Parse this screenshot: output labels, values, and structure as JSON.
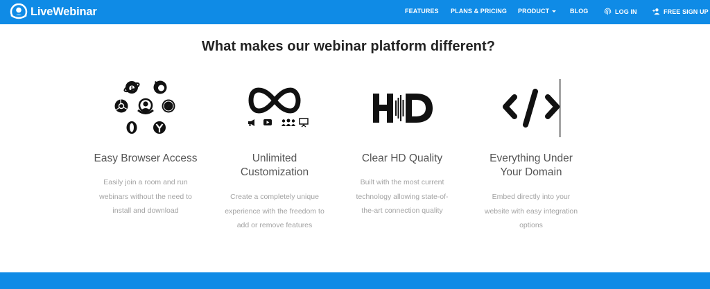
{
  "brand": {
    "name": "LiveWebinar",
    "color": "#0f8be6"
  },
  "nav": {
    "features": "FEATURES",
    "plans": "PLANS & PRICING",
    "product": "PRODUCT",
    "blog": "BLOG",
    "login": "LOG IN",
    "signup": "FREE SIGN UP"
  },
  "main": {
    "headline": "What makes our webinar platform different?",
    "features": [
      {
        "title": "Easy Browser Access",
        "desc": [
          "Easily join a room and run",
          "webinars without the need to",
          "install and download"
        ],
        "icon": "browsers-icon"
      },
      {
        "title": [
          "Unlimited",
          "Customization"
        ],
        "desc": [
          "Create a completely unique",
          "experience with the freedom to",
          "add or remove features"
        ],
        "icon": "infinity-icon"
      },
      {
        "title": "Clear HD Quality",
        "desc": [
          "Built with the most current",
          "technology allowing state-of-",
          "the-art connection quality"
        ],
        "icon": "hd-icon"
      },
      {
        "title": [
          "Everything Under",
          "Your Domain"
        ],
        "desc": [
          "Embed directly into your",
          "website with easy integration",
          "options"
        ],
        "icon": "code-icon"
      }
    ]
  }
}
